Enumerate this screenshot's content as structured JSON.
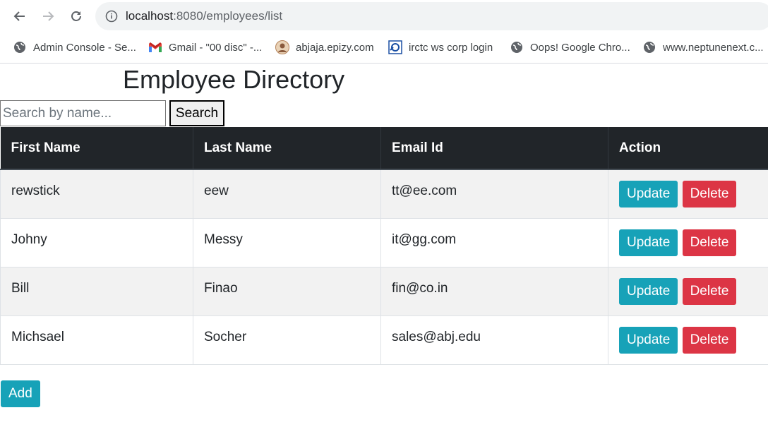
{
  "browser": {
    "url_host": "localhost",
    "url_rest": ":8080/employees/list",
    "bookmarks": [
      {
        "label": "Admin Console - Se...",
        "icon": "globe-icon"
      },
      {
        "label": "Gmail - \"00 disc\" -...",
        "icon": "gmail-icon"
      },
      {
        "label": "abjaja.epizy.com",
        "icon": "avatar-icon"
      },
      {
        "label": "irctc ws corp login",
        "icon": "irctc-icon"
      },
      {
        "label": "Oops! Google Chro...",
        "icon": "globe-icon"
      },
      {
        "label": "www.neptunenext.c...",
        "icon": "globe-icon"
      }
    ]
  },
  "page": {
    "title": "Employee Directory",
    "search": {
      "placeholder": "Search by name...",
      "value": "",
      "button": "Search"
    },
    "table": {
      "headers": [
        "First Name",
        "Last Name",
        "Email Id",
        "Action"
      ],
      "rows": [
        {
          "first": "rewstick",
          "last": "eew",
          "email": "tt@ee.com"
        },
        {
          "first": "Johny",
          "last": "Messy",
          "email": "it@gg.com"
        },
        {
          "first": "Bill",
          "last": "Finao",
          "email": "fin@co.in"
        },
        {
          "first": "Michsael",
          "last": "Socher",
          "email": "sales@abj.edu"
        }
      ],
      "update_label": "Update",
      "delete_label": "Delete"
    },
    "add_label": "Add"
  },
  "colors": {
    "header_bg": "#212529",
    "info": "#17a2b8",
    "danger": "#dc3545",
    "stripe": "#f2f2f2"
  }
}
